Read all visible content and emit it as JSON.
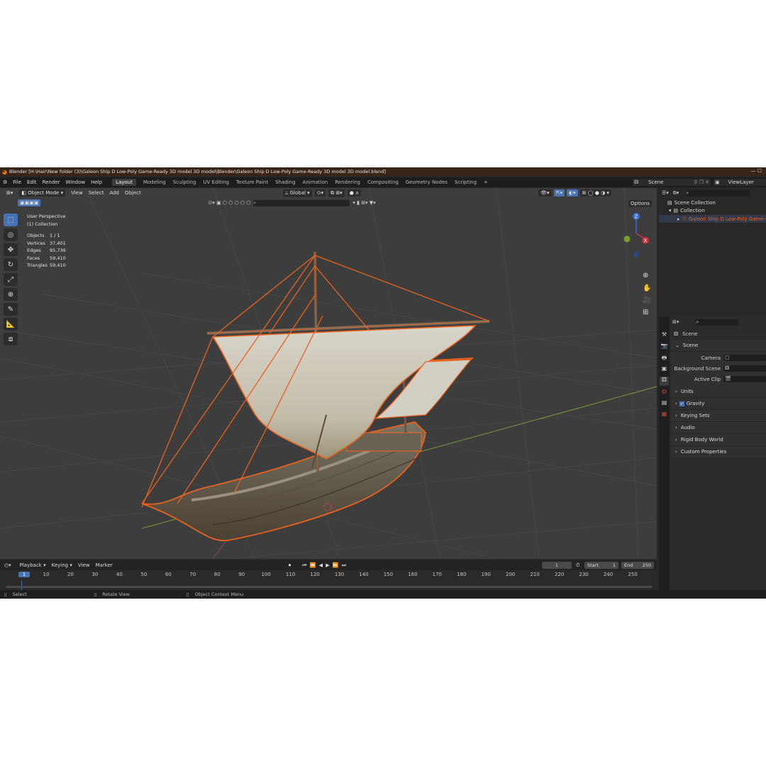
{
  "window": {
    "title": "Blender [H:\\Hair\\New folder (3)\\Galeon Ship D Low-Poly Game-Ready 3D model 3D model\\Blender\\Galeon Ship D Low-Poly Game-Ready 3D model 3D model.blend]",
    "controls": "—  ☐"
  },
  "menu": [
    "File",
    "Edit",
    "Render",
    "Window",
    "Help"
  ],
  "workspaces": [
    "Layout",
    "Modeling",
    "Sculpting",
    "UV Editing",
    "Texture Paint",
    "Shading",
    "Animation",
    "Rendering",
    "Compositing",
    "Geometry Nodes",
    "Scripting",
    "+"
  ],
  "top_right": {
    "scene": "Scene",
    "view_layer": "ViewLayer"
  },
  "viewport_header": {
    "mode": "Object Mode",
    "menus": [
      "View",
      "Select",
      "Add",
      "Object"
    ],
    "orientation": "Global",
    "options": "Options"
  },
  "overlay": {
    "view_name": "User Perspective",
    "collection": "(1) Collection",
    "stats": [
      {
        "label": "Objects",
        "value": "1 / 1"
      },
      {
        "label": "Vertices",
        "value": "37,401"
      },
      {
        "label": "Edges",
        "value": "95,736"
      },
      {
        "label": "Faces",
        "value": "59,410"
      },
      {
        "label": "Triangles",
        "value": "59,410"
      }
    ]
  },
  "gizmo": {
    "z": "Z",
    "x": "X"
  },
  "outliner": {
    "scene_collection": "Scene Collection",
    "collection": "Collection",
    "object": "Galeon Ship D Low-Poly Game-Ready"
  },
  "properties": {
    "header": "Scene",
    "section": "Scene",
    "fields": [
      {
        "label": "Camera"
      },
      {
        "label": "Background Scene"
      },
      {
        "label": "Active Clip"
      }
    ],
    "panels": [
      "Units",
      "Gravity",
      "Keying Sets",
      "Audio",
      "Rigid Body World",
      "Custom Properties"
    ],
    "gravity_checked": true
  },
  "timeline": {
    "menus": [
      "Playback",
      "Keying",
      "View",
      "Marker"
    ],
    "current_frame": "1",
    "start_label": "Start",
    "start": "1",
    "end_label": "End",
    "end": "250",
    "ticks": [
      "1",
      "10",
      "20",
      "30",
      "40",
      "50",
      "60",
      "70",
      "80",
      "90",
      "100",
      "110",
      "120",
      "130",
      "140",
      "150",
      "160",
      "170",
      "180",
      "190",
      "200",
      "210",
      "220",
      "230",
      "240",
      "250"
    ]
  },
  "statusbar": {
    "select": "Select",
    "rotate": "Rotate View",
    "context": "Object Context Menu"
  },
  "colors": {
    "selection": "#e8621f",
    "accent": "#4772b3",
    "title_bg": "#3a2418"
  }
}
